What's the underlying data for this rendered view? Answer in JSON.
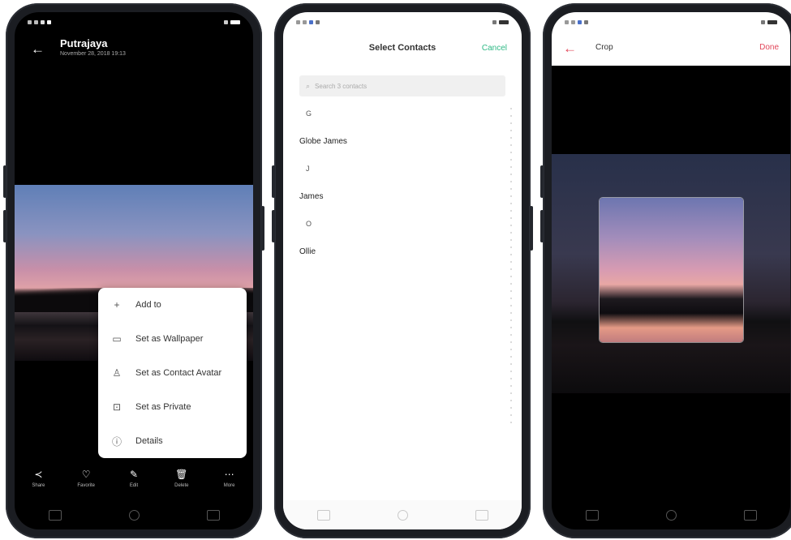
{
  "phone1": {
    "gallery": {
      "title": "Putrajaya",
      "subtitle": "November 28, 2018 19:13"
    },
    "menu": [
      {
        "icon": "plus-icon",
        "glyph": "+",
        "label": "Add to"
      },
      {
        "icon": "wallpaper-icon",
        "glyph": "▭",
        "label": "Set as Wallpaper"
      },
      {
        "icon": "person-icon",
        "glyph": "♙",
        "label": "Set as Contact Avatar"
      },
      {
        "icon": "lock-icon",
        "glyph": "⊡",
        "label": "Set as Private"
      },
      {
        "icon": "info-icon",
        "glyph": "ⓘ",
        "label": "Details"
      }
    ],
    "actions": [
      {
        "icon": "share-icon",
        "glyph": "≺",
        "label": "Share"
      },
      {
        "icon": "heart-icon",
        "glyph": "♡",
        "label": "Favorite"
      },
      {
        "icon": "edit-icon",
        "glyph": "✎",
        "label": "Edit"
      },
      {
        "icon": "trash-icon",
        "glyph": "🗑",
        "label": "Delete"
      },
      {
        "icon": "more-icon",
        "glyph": "⋯",
        "label": "More"
      }
    ]
  },
  "phone2": {
    "header": {
      "title": "Select Contacts",
      "cancel": "Cancel"
    },
    "search": {
      "placeholder": "Search 3 contacts"
    },
    "contacts": [
      {
        "type": "letter",
        "text": "G"
      },
      {
        "type": "name",
        "text": "Globe James"
      },
      {
        "type": "letter",
        "text": "J"
      },
      {
        "type": "name",
        "text": "James"
      },
      {
        "type": "letter",
        "text": "O"
      },
      {
        "type": "name",
        "text": "Ollie"
      }
    ]
  },
  "phone3": {
    "header": {
      "title": "Crop",
      "done": "Done"
    }
  },
  "colors": {
    "accent_green": "#2eb985",
    "accent_red": "#e2475a"
  }
}
